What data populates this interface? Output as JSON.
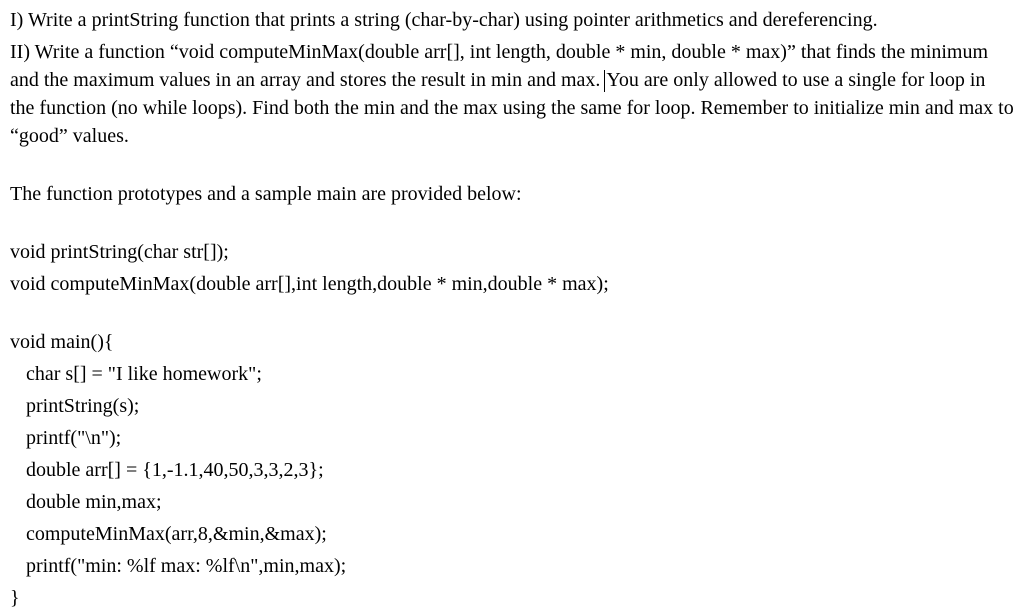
{
  "problem1": "I) Write a printString function that prints a string (char-by-char) using pointer arithmetics and dereferencing.",
  "problem2_a": "II) Write a function “void computeMinMax(double arr[], int length, double * min, double *  max)” that finds the minimum and the maximum values in an array and stores the result in min and max. ",
  "problem2_b": "You are only allowed to use a single for loop in the function (no while loops). Find both the min and the max using the same for loop. Remember to initialize min and max to “good” values.",
  "prototypes_intro": "The function prototypes and a sample main are provided below:",
  "proto1": "void printString(char str[]);",
  "proto2": "void computeMinMax(double arr[],int length,double * min,double * max);",
  "code": {
    "l1": "void main(){",
    "l2": "char s[] = \"I like homework\";",
    "l3": "printString(s);",
    "l4": "printf(\"\\n\");",
    "l5": "double arr[] = {1,-1.1,40,50,3,3,2,3};",
    "l6": "double min,max;",
    "l7": "computeMinMax(arr,8,&min,&max);",
    "l8": "printf(\"min: %lf max: %lf\\n\",min,max);",
    "l9": "}"
  }
}
